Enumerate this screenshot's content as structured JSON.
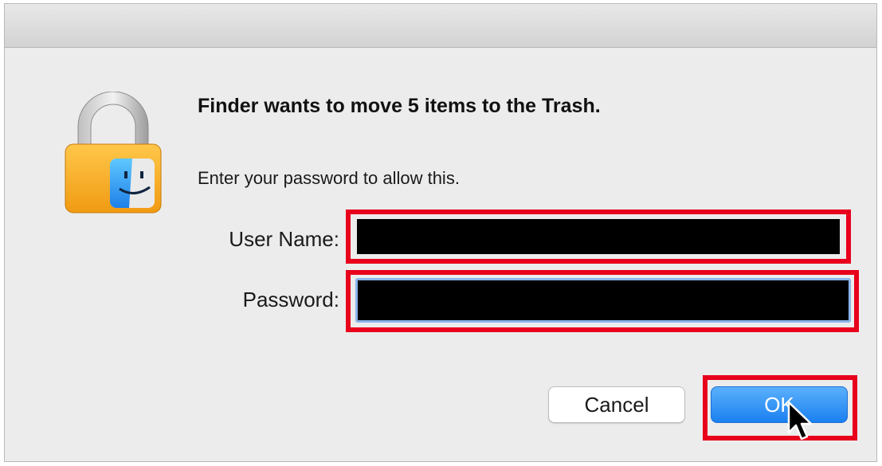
{
  "dialog": {
    "heading": "Finder wants to move 5 items to the Trash.",
    "subtext": "Enter your password to allow this.",
    "icon": "lock-finder-icon"
  },
  "form": {
    "username_label": "User Name:",
    "username_value": "",
    "password_label": "Password:",
    "password_value": ""
  },
  "buttons": {
    "cancel": "Cancel",
    "ok": "OK"
  },
  "colors": {
    "highlight": "#e8001c",
    "accent": "#1b80f0",
    "focus_ring": "#8ab4ea",
    "redaction": "#000000"
  }
}
